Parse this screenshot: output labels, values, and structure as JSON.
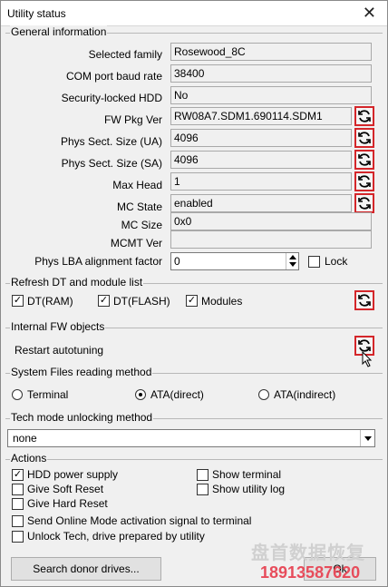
{
  "window": {
    "title": "Utility status"
  },
  "general": {
    "title": "General information",
    "selected_family": {
      "label": "Selected family",
      "value": "Rosewood_8C"
    },
    "com_baud": {
      "label": "COM port baud rate",
      "value": "38400"
    },
    "security_locked": {
      "label": "Security-locked HDD",
      "value": "No"
    },
    "fw_pkg": {
      "label": "FW Pkg Ver",
      "value": "RW08A7.SDM1.690114.SDM1"
    },
    "phys_ua": {
      "label": "Phys Sect. Size (UA)",
      "value": "4096"
    },
    "phys_sa": {
      "label": "Phys Sect. Size (SA)",
      "value": "4096"
    },
    "max_head": {
      "label": "Max Head",
      "value": "1"
    },
    "mc_state": {
      "label": "MC State",
      "value": "enabled"
    },
    "mc_size": {
      "label": "MC Size",
      "value": "0x0"
    },
    "mcmt_ver": {
      "label": "MCMT Ver",
      "value": ""
    },
    "lba_align": {
      "label": "Phys LBA alignment factor",
      "value": "0",
      "lock_label": "Lock"
    }
  },
  "refresh": {
    "title": "Refresh DT and module list",
    "dt_ram": "DT(RAM)",
    "dt_flash": "DT(FLASH)",
    "modules": "Modules"
  },
  "internal": {
    "title": "Internal FW objects",
    "restart": "Restart autotuning"
  },
  "sysfiles": {
    "title": "System Files reading method",
    "terminal": "Terminal",
    "ata_direct": "ATA(direct)",
    "ata_indirect": "ATA(indirect)"
  },
  "techmode": {
    "title": "Tech mode unlocking method",
    "selected": "none"
  },
  "actions": {
    "title": "Actions",
    "hdd_power": "HDD power supply",
    "soft_reset": "Give Soft Reset",
    "hard_reset": "Give Hard Reset",
    "online_mode": "Send Online Mode activation signal to terminal",
    "unlock_tech": "Unlock Tech, drive prepared by utility",
    "show_terminal": "Show terminal",
    "show_log": "Show utility log"
  },
  "buttons": {
    "search_donor": "Search donor drives...",
    "ok": "Ok"
  },
  "watermark": {
    "brand": "盘首数据恢复",
    "phone": "18913587620"
  },
  "colors": {
    "highlight": "#d4262a"
  }
}
